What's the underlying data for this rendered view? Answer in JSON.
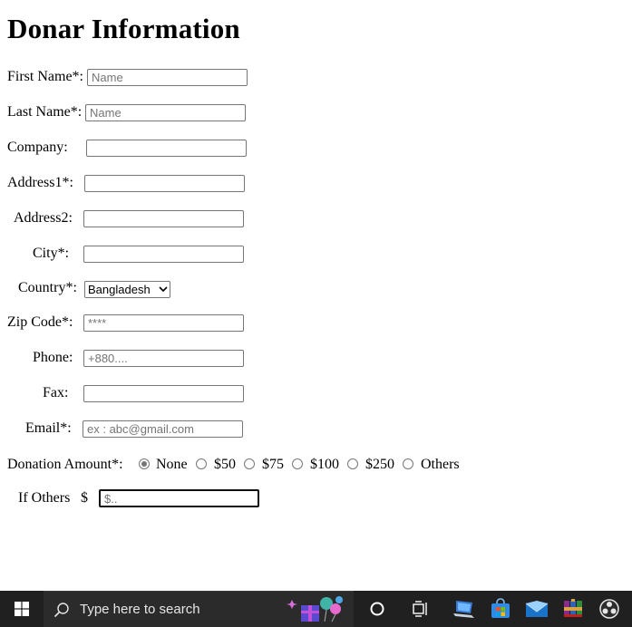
{
  "form": {
    "title": "Donar Information",
    "first_name": {
      "label": "First Name*:",
      "placeholder": "Name"
    },
    "last_name": {
      "label": "Last Name*:",
      "placeholder": "Name"
    },
    "company": {
      "label": "Company:"
    },
    "address1": {
      "label": "Address1*:"
    },
    "address2": {
      "label": "Address2:"
    },
    "city": {
      "label": "City*:"
    },
    "country": {
      "label": "Country*:",
      "selected": "Bangladesh"
    },
    "zip": {
      "label": "Zip Code*:",
      "placeholder": "****"
    },
    "phone": {
      "label": "Phone:",
      "placeholder": "+880...."
    },
    "fax": {
      "label": "Fax:"
    },
    "email": {
      "label": "Email*:",
      "placeholder": "ex : abc@gmail.com"
    },
    "donation": {
      "label": "Donation Amount*:",
      "options": [
        "None",
        "$50",
        "$75",
        "$100",
        "$250",
        "Others"
      ],
      "selected": "None"
    },
    "others": {
      "label": "If Others",
      "currency": "$",
      "placeholder": "$.."
    }
  },
  "taskbar": {
    "search_placeholder": "Type here to search",
    "icons": [
      "windows-start-icon",
      "search-icon",
      "cortana-circle-icon",
      "task-view-icon",
      "laptop-app-icon",
      "store-icon",
      "mail-icon",
      "winrar-icon",
      "obs-icon"
    ]
  },
  "colors": {
    "taskbar": "#202020",
    "search_box": "#2b2b2b",
    "input_border": "#767676"
  }
}
